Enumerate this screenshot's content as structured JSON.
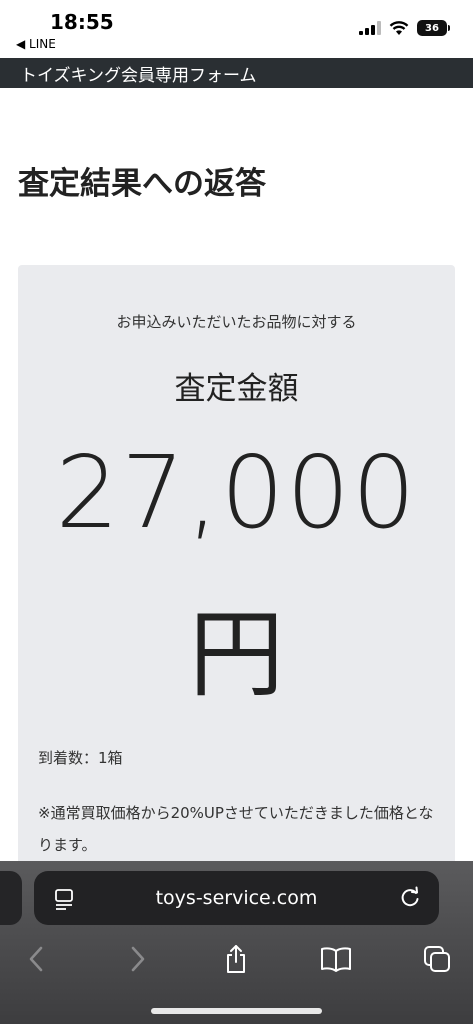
{
  "status_bar": {
    "time": "18:55",
    "back_app": "◀ LINE",
    "battery": "36"
  },
  "form_header": "トイズキング会員専用フォーム",
  "page_title": "査定結果への返答",
  "card": {
    "lead": "お申込みいただいたお品物に対する",
    "amount_label": "査定金額",
    "amount_value": "27,000",
    "amount_unit": "円",
    "count": "到着数：1箱",
    "note": "※通常買取価格から20%UPさせていただきました価格となります。"
  },
  "browser": {
    "url": "toys-service.com"
  },
  "colors": {
    "header_bg": "#2a2f33",
    "card_bg": "#eaebee",
    "toolbar_bg": "#4a4a4c"
  }
}
